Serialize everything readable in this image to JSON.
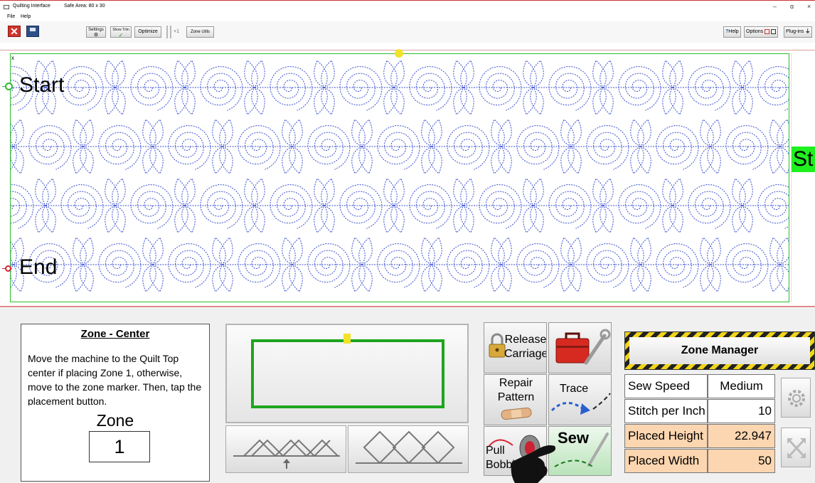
{
  "window": {
    "title": "Quilting Interface",
    "safe_area": "Safe Area: 80 x 30",
    "minimize": "–",
    "restore": "ɑ",
    "close": "×"
  },
  "menu": {
    "file": "File",
    "help": "Help"
  },
  "toolbar": {
    "settings_label": "Settings",
    "show_trim_label": "Show Trim",
    "optimize_label": "Optimize",
    "plus_label": "+1",
    "zone_utils_label": "Zone Utils",
    "help_label": "Help",
    "help_mark": "?",
    "options_label": "Options",
    "plugins_label": "Plug-ins"
  },
  "canvas": {
    "start_label": "Start",
    "end_label": "End",
    "right_badge": "St",
    "corner_mark": "x",
    "pattern_color": "#3a4fd0",
    "border_color": "#2bbf2b"
  },
  "instructions": {
    "title": "Zone - Center",
    "text": "Move the machine to the Quilt Top center if placing Zone 1, otherwise, move to the zone marker. Then, tap the placement button.",
    "zone_label": "Zone",
    "zone_value": "1"
  },
  "actions": {
    "release_carriage": "Release Carriage",
    "repair_pattern": "Repair Pattern",
    "trace": "Trace",
    "pull_bobbin": "Pull Bobbin",
    "sew": "Sew"
  },
  "zone_manager": {
    "title": "Zone Manager",
    "rows": [
      {
        "label": "Sew Speed",
        "value": "Medium"
      },
      {
        "label": "Stitch per Inch",
        "value": "10"
      },
      {
        "label": "Placed Height",
        "value": "22.947"
      },
      {
        "label": "Placed Width",
        "value": "50"
      }
    ]
  }
}
